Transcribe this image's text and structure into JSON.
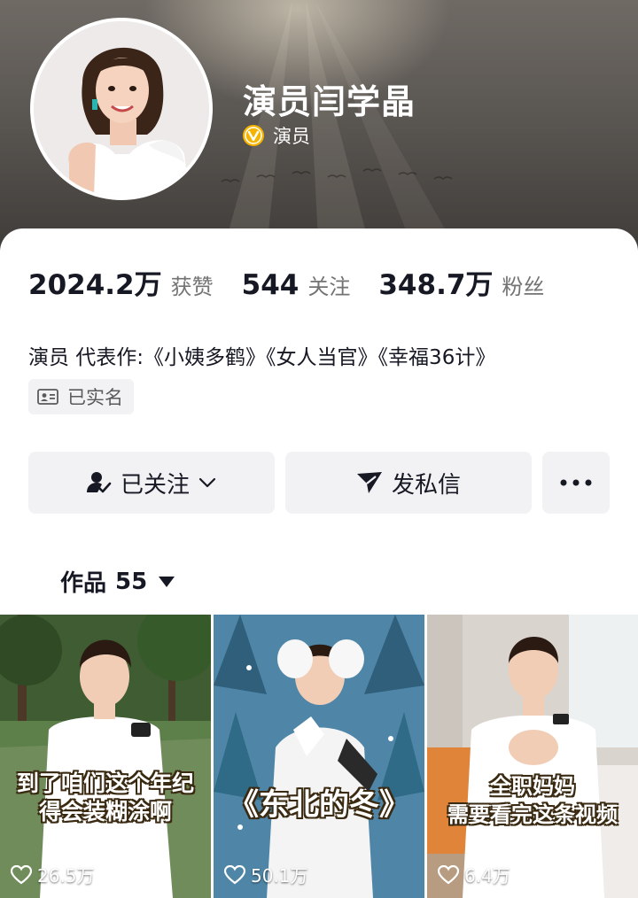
{
  "profile": {
    "name": "演员闫学晶",
    "verified_label": "演员"
  },
  "stats": [
    {
      "value": "2024.2万",
      "label": "获赞"
    },
    {
      "value": "544",
      "label": "关注"
    },
    {
      "value": "348.7万",
      "label": "粉丝"
    }
  ],
  "bio": "演员 代表作:《小姨多鹤》《女人当官》《幸福36计》",
  "realname_tag": "已实名",
  "actions": {
    "follow_label": "已关注",
    "message_label": "发私信"
  },
  "tabs": {
    "works_label": "作品",
    "works_count": "55"
  },
  "videos": [
    {
      "caption_line1": "到了咱们这个年纪",
      "caption_line2": "得会装糊涂啊",
      "likes": "26.5万"
    },
    {
      "caption_line1": "《东北的冬》",
      "caption_line2": "",
      "likes": "50.1万"
    },
    {
      "caption_line1": "全职妈妈",
      "caption_line2": "需要看完这条视频",
      "likes": "6.4万"
    }
  ],
  "colors": {
    "verify_badge": "#f5b400",
    "button_bg": "#f2f2f4",
    "text_primary": "#161823",
    "text_secondary": "#737373"
  },
  "icons": {
    "verify": "verified-badge-icon",
    "id_card": "id-card-icon",
    "followed_user": "user-check-icon",
    "chevron": "chevron-down-icon",
    "send": "paper-plane-icon",
    "more": "more-dots-icon",
    "caret": "caret-down-icon",
    "heart": "heart-icon"
  }
}
